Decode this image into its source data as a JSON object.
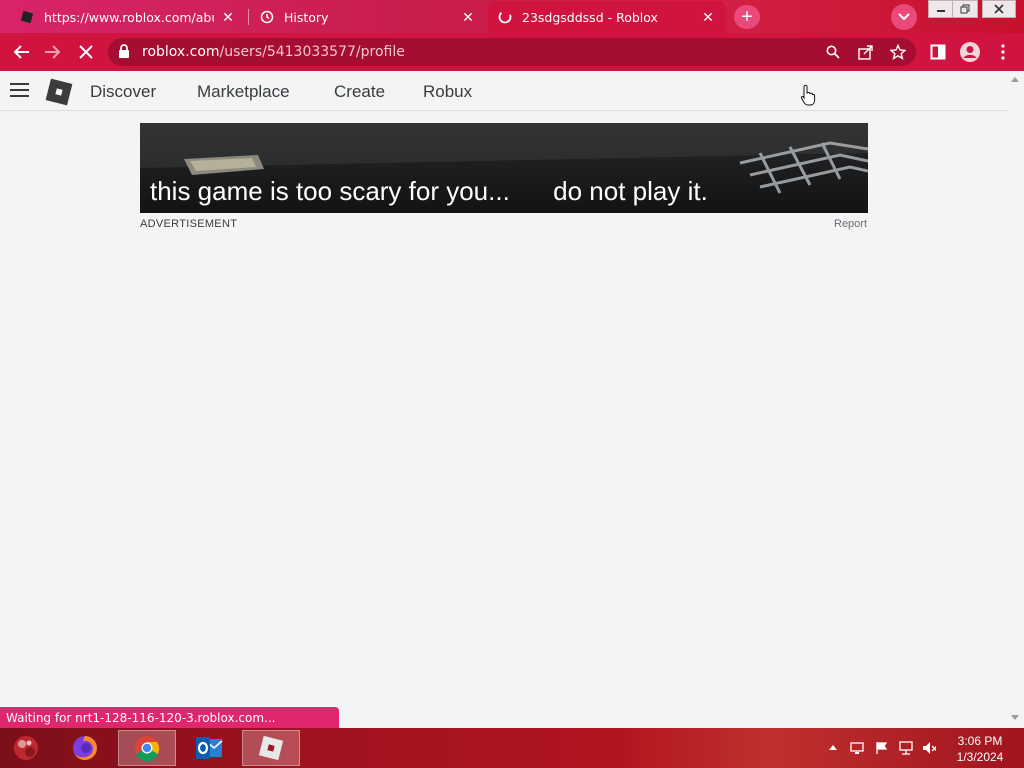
{
  "browser": {
    "tabs": [
      {
        "title": "https://www.roblox.com/abusere",
        "active": false
      },
      {
        "title": "History",
        "active": false
      },
      {
        "title": "23sdgsddssd - Roblox",
        "active": true
      }
    ],
    "url_host": "roblox.com",
    "url_path": "/users/5413033577/profile",
    "status_text": "Waiting for nrt1-128-116-120-3.roblox.com..."
  },
  "header": {
    "nav": [
      "Discover",
      "Marketplace",
      "Create",
      "Robux"
    ]
  },
  "ad": {
    "text_left": "this game is too scary for you...",
    "text_right": "do not play it.",
    "label": "ADVERTISEMENT",
    "report": "Report"
  },
  "taskbar": {
    "time": "3:06 PM",
    "date": "1/3/2024",
    "apps": [
      "firefox-icon",
      "chrome-icon",
      "outlook-icon",
      "roblox-icon"
    ]
  },
  "colors": {
    "browser_accent": "#d0143f",
    "page_bg": "#f2f4f5"
  }
}
